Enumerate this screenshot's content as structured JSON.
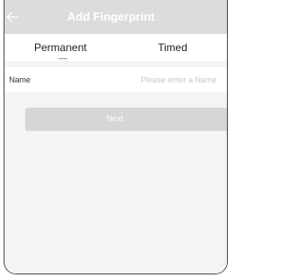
{
  "header": {
    "back_icon": "arrow-left-icon",
    "title": "Add Fingerprint"
  },
  "tabs": [
    {
      "label": "Permanent",
      "selected": true
    },
    {
      "label": "Timed",
      "selected": false
    }
  ],
  "form": {
    "name_label": "Name",
    "name_placeholder": "Please enter a Name",
    "name_value": ""
  },
  "actions": {
    "next_label": "Next"
  },
  "colors": {
    "header_bg": "#dcdcdc",
    "page_bg": "#f4f4f4",
    "button_bg": "#d6d6d6",
    "frame_border": "#4a4a4a"
  }
}
